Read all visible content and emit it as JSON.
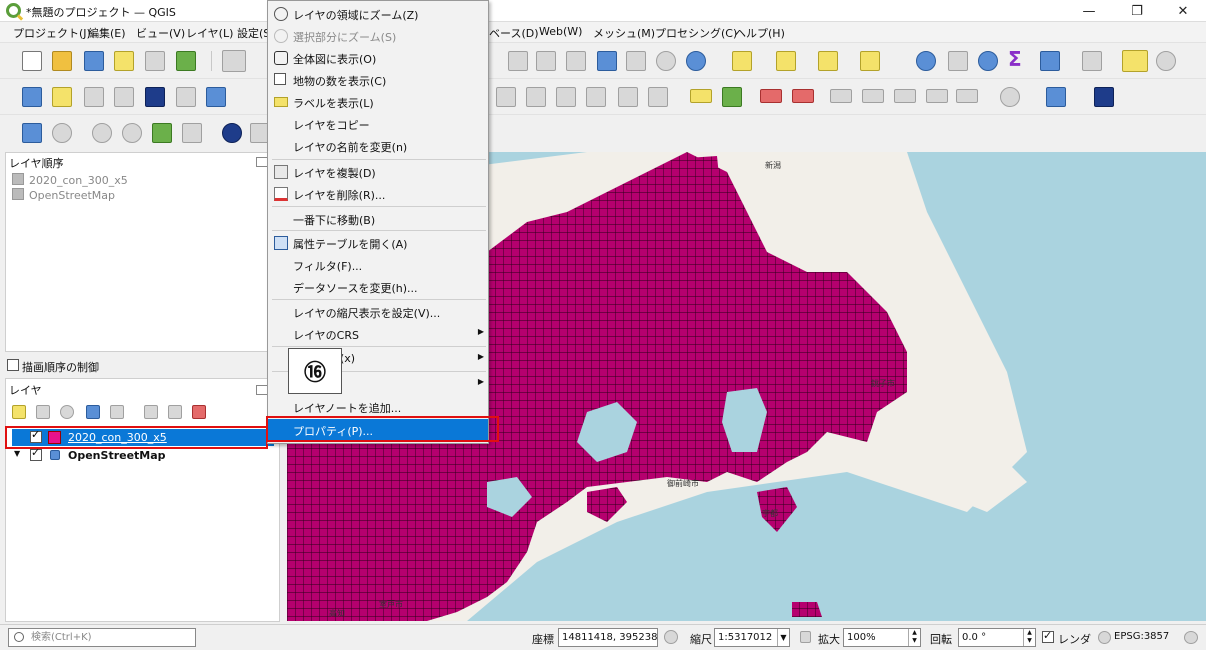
{
  "window": {
    "title": "*無題のプロジェクト — QGIS",
    "minimize": "—",
    "restore": "❐",
    "close": "✕"
  },
  "menubar": {
    "items": [
      "プロジェクト(J)",
      "編集(E)",
      "ビュー(V)",
      "レイヤ(L)",
      "設定(S",
      "ベース(D)",
      "Web(W)",
      "メッシュ(M)",
      "プロセシング(C)",
      "ヘルプ(H)"
    ]
  },
  "layer_order_panel": {
    "title": "レイヤ順序",
    "items": [
      "2020_con_300_x5",
      "OpenStreetMap"
    ],
    "control_order_label": "描画順序の制御"
  },
  "layers_panel": {
    "title": "レイヤ",
    "layers": [
      {
        "name": "2020_con_300_x5",
        "checked": true,
        "selected": true,
        "color": "#e8128c"
      },
      {
        "name": "OpenStreetMap",
        "checked": true,
        "selected": false
      }
    ]
  },
  "context_menu": {
    "items": [
      {
        "label": "レイヤの領域にズーム(Z)",
        "icon": "zoom-layer-icon",
        "disabled": false
      },
      {
        "label": "選択部分にズーム(S)",
        "icon": "zoom-selection-icon",
        "disabled": true
      },
      {
        "label": "全体図に表示(O)",
        "icon": "overview-icon",
        "disabled": false
      },
      {
        "label": "地物の数を表示(C)",
        "icon": "checkbox-icon",
        "disabled": false
      },
      {
        "label": "ラベルを表示(L)",
        "icon": "label-icon",
        "disabled": false
      },
      {
        "label": "レイヤをコピー",
        "icon": "",
        "disabled": false
      },
      {
        "label": "レイヤの名前を変更(n)",
        "icon": "",
        "disabled": false
      },
      {
        "label": "レイヤを複製(D)",
        "icon": "duplicate-icon",
        "disabled": false
      },
      {
        "label": "レイヤを削除(R)...",
        "icon": "remove-layer-icon",
        "disabled": false
      },
      {
        "label": "一番下に移動(B)",
        "icon": "",
        "disabled": false
      },
      {
        "label": "属性テーブルを開く(A)",
        "icon": "table-icon",
        "disabled": false
      },
      {
        "label": "フィルタ(F)...",
        "icon": "",
        "disabled": false
      },
      {
        "label": "データソースを変更(h)...",
        "icon": "",
        "disabled": false
      },
      {
        "label": "レイヤの縮尺表示を設定(V)...",
        "icon": "",
        "disabled": false
      },
      {
        "label": "レイヤのCRS",
        "icon": "",
        "disabled": false,
        "submenu": true
      },
      {
        "label": "(x)",
        "icon": "",
        "disabled": false,
        "submenu": true
      },
      {
        "label": "",
        "icon": "",
        "disabled": false,
        "submenu": true
      },
      {
        "label": "レイヤノートを追加...",
        "icon": "",
        "disabled": false
      },
      {
        "label": "プロパティ(P)...",
        "icon": "",
        "disabled": false,
        "highlighted": true
      }
    ],
    "submenu_arrow": "▶"
  },
  "annotation": {
    "marker": "⑯"
  },
  "map": {
    "labels": [
      "新潟",
      "高知",
      "室戸市",
      "御前崎市",
      "宇都",
      "銚子市"
    ]
  },
  "statusbar": {
    "search_placeholder": "検索(Ctrl+K)",
    "coordinate_label": "座標",
    "coordinate_value": "14811418, 3952384",
    "scale_label": "縮尺",
    "scale_value": "1:5317012",
    "magnifier_label": "拡大",
    "magnifier_value": "100%",
    "rotation_label": "回転",
    "rotation_value": "0.0 °",
    "render_label": "レンダ",
    "render_checked": true,
    "crs": "EPSG:3857"
  }
}
